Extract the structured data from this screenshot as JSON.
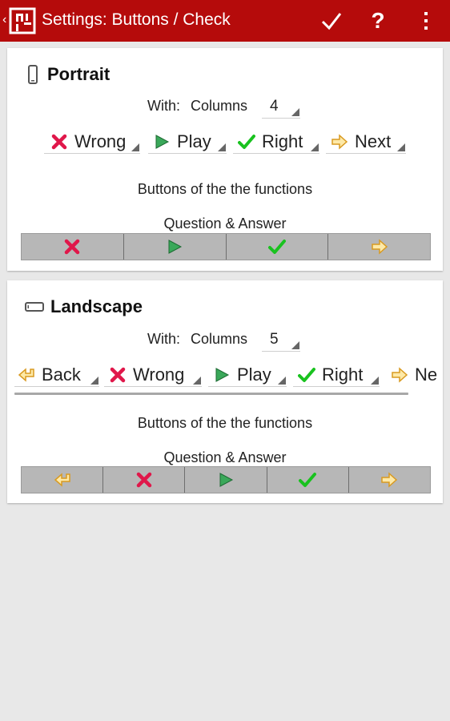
{
  "appbar": {
    "title": "Settings: Buttons / Check",
    "back_glyph": "‹",
    "actions": [
      "check-icon",
      "help-icon",
      "overflow-menu-icon"
    ],
    "help_glyph": "?"
  },
  "colors": {
    "appbar": "#b50b0b",
    "wrong": "#e0174a",
    "play": "#3aa85a",
    "right": "#19c21f",
    "arrow": "#f2b030"
  },
  "portrait": {
    "title": "Portrait",
    "with_label": "With:",
    "columns_label": "Columns",
    "columns_value": "4",
    "buttons": [
      {
        "icon": "wrong-x-icon",
        "label": "Wrong"
      },
      {
        "icon": "play-icon",
        "label": "Play"
      },
      {
        "icon": "right-check-icon",
        "label": "Right"
      },
      {
        "icon": "next-arrow-icon",
        "label": "Next"
      }
    ],
    "functions_label": "Buttons of the the functions",
    "qa_label": "Question & Answer"
  },
  "landscape": {
    "title": "Landscape",
    "with_label": "With:",
    "columns_label": "Columns",
    "columns_value": "5",
    "buttons": [
      {
        "icon": "back-arrow-icon",
        "label": "Back"
      },
      {
        "icon": "wrong-x-icon",
        "label": "Wrong"
      },
      {
        "icon": "play-icon",
        "label": "Play"
      },
      {
        "icon": "right-check-icon",
        "label": "Right"
      },
      {
        "icon": "next-arrow-icon",
        "label": "Ne"
      }
    ],
    "functions_label": "Buttons of the the functions",
    "qa_label": "Question & Answer"
  }
}
